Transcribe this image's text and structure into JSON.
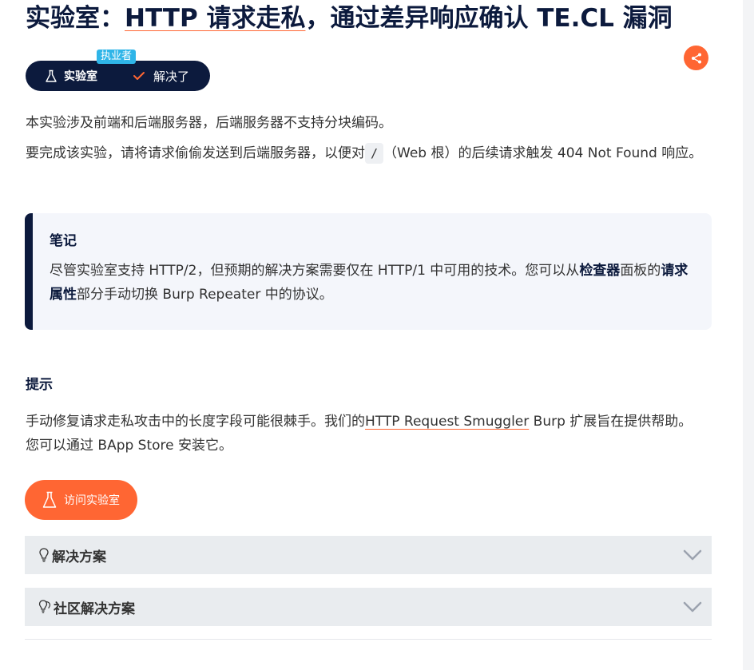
{
  "title": {
    "prefix": "实验室：",
    "link": "HTTP 请求走私",
    "suffix": "，通过差异响应确认 TE.CL 漏洞"
  },
  "badge": {
    "tag": "执业者",
    "lab_label": "实验室",
    "status_label": "解决了"
  },
  "intro": {
    "line1": "本实验涉及前端和后端服务器，后端服务器不支持分块编码。",
    "line2_before": "要完成该实验，请将请求偷偷发送到后端服务器，以便对",
    "code": "/",
    "line2_after": "（Web 根）的后续请求触发 404 Not Found 响应。"
  },
  "note": {
    "title": "笔记",
    "text_a": "尽管实验室支持 HTTP/2，但预期的解决方案需要仅在 HTTP/1 中可用的技术。您可以从",
    "bold1": "检查器",
    "text_b": "面板的",
    "bold2": "请求属性",
    "text_c": "部分手动切换 Burp Repeater 中的协议。"
  },
  "hint": {
    "title": "提示",
    "before": "手动修复请求走私攻击中的长度字段可能很棘手。我们的",
    "link": "HTTP Request Smuggler",
    "after": " Burp 扩展旨在提供帮助。您可以通过 BApp Store 安装它。"
  },
  "visit_button": "访问实验室",
  "accordions": {
    "solution": "解决方案",
    "community": "社区解决方案"
  },
  "colors": {
    "navy": "#0c1a3d",
    "orange": "#ff6633",
    "tag_blue": "#2fb5e8"
  }
}
